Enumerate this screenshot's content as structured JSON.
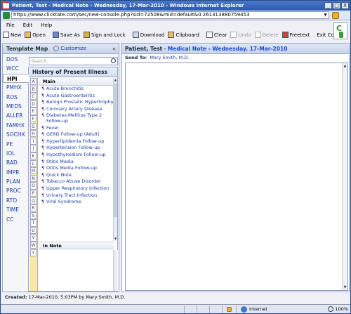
{
  "window": {
    "title": "Patient, Test - Medical Note - Wednesday, 17-Mar-2010 - Windows Internet Explorer",
    "controls": [
      "_",
      "□",
      "X"
    ]
  },
  "address": {
    "url": "https://www.clicktate.com/sec/new-console.php?sid=72508&mid=default&0.261313880759453"
  },
  "menu": [
    "File",
    "Edit",
    "Help"
  ],
  "toolbar": {
    "new": "New",
    "open": "Open",
    "save_as": "Save As",
    "sign_lock": "Sign and Lock",
    "download": "Download",
    "clipboard": "Clipboard",
    "clear": "Clear",
    "undo": "Undo",
    "delete": "Delete",
    "freetext": "Freetext",
    "exit": "Exit Console"
  },
  "template_map": {
    "title": "Template Map",
    "customize": "Customize",
    "collapse": "«"
  },
  "nav": [
    "DOS",
    "WCC",
    "HPI",
    "PMHX",
    "ROS",
    "MEDS",
    "ALLER",
    "FAMHX",
    "SOCHX",
    "PE",
    "IOL",
    "RAD",
    "IMPR",
    "PLAN",
    "PROC",
    "RTO",
    "TIME",
    "CC"
  ],
  "nav_active": "HPI",
  "search": {
    "placeholder": "Search..."
  },
  "hpi": {
    "title": "History of Present Illness",
    "main_label": "Main",
    "in_note_label": "In Note",
    "items": [
      "Acute Bronchitis",
      "Acute Gastroenteritis",
      "Benign Prostatic Hypertrophy",
      "Coronary Artery Disease",
      "Diabetes Mellitus Type 2 Follow-up",
      "Fever",
      "GERD Follow-up (Adult)",
      "Hyperlipidemia Follow-up",
      "Hypertension Follow-up",
      "Hypothyroidism Follow-up",
      "Otitis Media",
      "Otitis Media Follow-up",
      "Quick Note",
      "Tobacco Abuse Disorder",
      "Upper Respiratory Infection",
      "Urinary Tract Infection",
      "Viral Syndrome"
    ],
    "letters": [
      "A",
      "B",
      "C",
      "D",
      "E",
      "F",
      "G",
      "H",
      "I",
      "J",
      "K",
      "L",
      "M",
      "N",
      "O",
      "P",
      "Q",
      "R",
      "S",
      "T",
      "U",
      "V",
      "W",
      "Y"
    ]
  },
  "note": {
    "patient": "Patient, Test",
    "separator": " - ",
    "title": "Medical Note - Wednesday, 17-Mar-2010",
    "send_to_label": "Send To:",
    "send_to_value": "Mary Smith, M.D."
  },
  "footer": {
    "created_label": "Created:",
    "created_value": "17-Mar-2010, 5:03PM by Mary Smith, M.D."
  },
  "status": {
    "zone": "Internet",
    "zoom": "100%"
  },
  "icons": {
    "para": "¶",
    "scroll_up": "▲",
    "scroll_down": "▼"
  }
}
